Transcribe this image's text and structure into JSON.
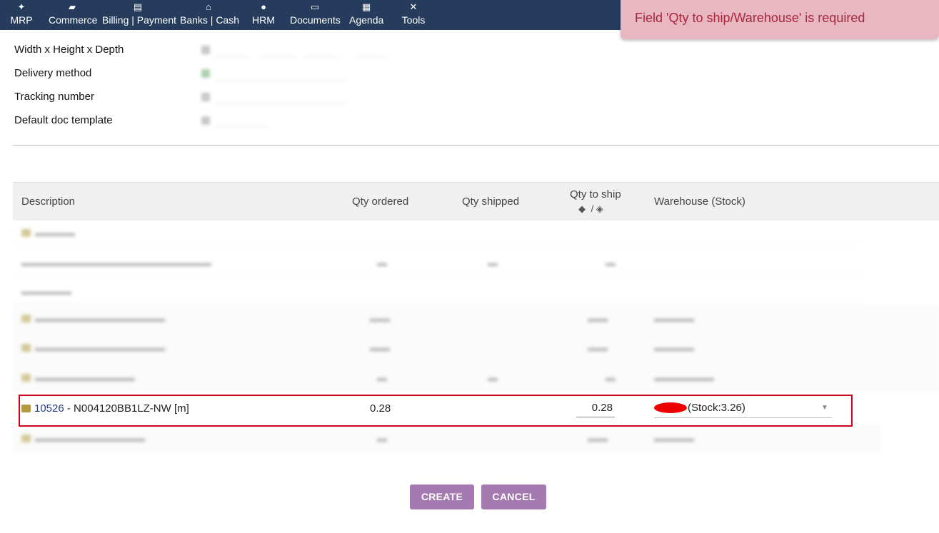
{
  "topbar": {
    "menu": [
      {
        "label": "MRP",
        "icon": "cubes-icon",
        "glyph": "✦"
      },
      {
        "label": "Commerce",
        "icon": "briefcase-icon",
        "glyph": "▰"
      },
      {
        "label": "Billing | Payment",
        "icon": "invoice-icon",
        "glyph": "▤"
      },
      {
        "label": "Banks | Cash",
        "icon": "bank-icon",
        "glyph": "⌂"
      },
      {
        "label": "HRM",
        "icon": "user-icon",
        "glyph": "●"
      },
      {
        "label": "Documents",
        "icon": "folder-open-icon",
        "glyph": "▭"
      },
      {
        "label": "Agenda",
        "icon": "calendar-icon",
        "glyph": "▦"
      },
      {
        "label": "Tools",
        "icon": "tools-icon",
        "glyph": "✕"
      }
    ]
  },
  "toast": {
    "message": "Field 'Qty to ship/Warehouse' is required"
  },
  "form": {
    "fields": [
      {
        "label": "Width x Height x Depth"
      },
      {
        "label": "Delivery method"
      },
      {
        "label": "Tracking number"
      },
      {
        "label": "Default doc template"
      }
    ]
  },
  "table": {
    "headers": {
      "description": "Description",
      "qty_ordered": "Qty ordered",
      "qty_shipped": "Qty shipped",
      "qty_to_ship": "Qty to ship",
      "qty_to_ship_sep": "/",
      "warehouse": "Warehouse (Stock)"
    },
    "highlighted_row": {
      "ref": "10526",
      "description": " - N004120BB1LZ-NW [m]",
      "qty_ordered": "0.28",
      "qty_to_ship": "0.28",
      "warehouse_stock": "(Stock:3.26)"
    }
  },
  "buttons": {
    "create": "CREATE",
    "cancel": "CANCEL"
  }
}
